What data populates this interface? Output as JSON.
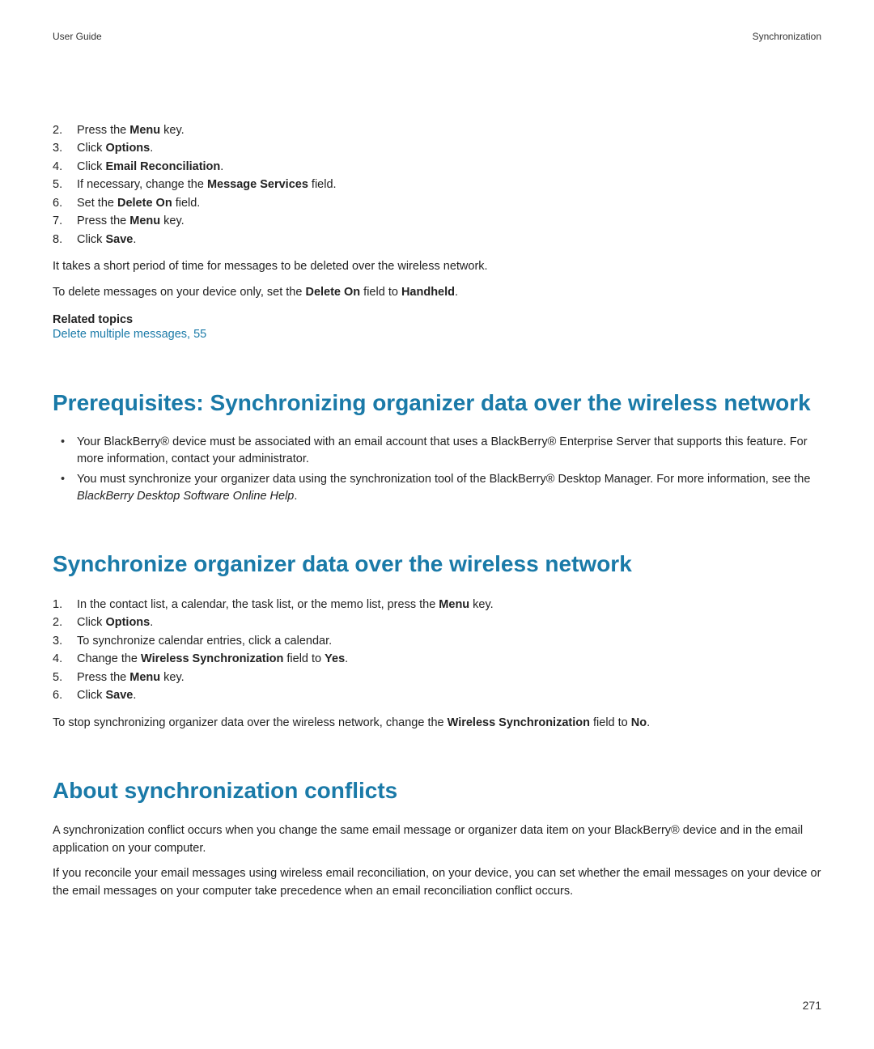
{
  "header": {
    "left": "User Guide",
    "right": "Synchronization"
  },
  "section1": {
    "steps": [
      {
        "num": "2.",
        "prefix": "Press the ",
        "bold": "Menu",
        "suffix": " key."
      },
      {
        "num": "3.",
        "prefix": "Click ",
        "bold": "Options",
        "suffix": "."
      },
      {
        "num": "4.",
        "prefix": "Click ",
        "bold": "Email Reconciliation",
        "suffix": "."
      },
      {
        "num": "5.",
        "prefix": "If necessary, change the ",
        "bold": "Message Services",
        "suffix": " field."
      },
      {
        "num": "6.",
        "prefix": "Set the ",
        "bold": "Delete On",
        "suffix": " field."
      },
      {
        "num": "7.",
        "prefix": "Press the ",
        "bold": "Menu",
        "suffix": " key."
      },
      {
        "num": "8.",
        "prefix": "Click ",
        "bold": "Save",
        "suffix": "."
      }
    ],
    "para1": "It takes a short period of time for messages to be deleted over the wireless network.",
    "para2_prefix": "To delete messages on your device only, set the ",
    "para2_bold1": "Delete On",
    "para2_mid": " field to ",
    "para2_bold2": "Handheld",
    "para2_suffix": ".",
    "related_heading": "Related topics",
    "related_link": "Delete multiple messages, 55"
  },
  "section2": {
    "heading": "Prerequisites: Synchronizing organizer data over the wireless network",
    "bullets": [
      {
        "text": "Your BlackBerry® device must be associated with an email account that uses a BlackBerry® Enterprise Server that supports this feature. For more information, contact your administrator."
      },
      {
        "text_prefix": "You must synchronize your organizer data using the synchronization tool of the BlackBerry® Desktop Manager. For more information, see the  ",
        "text_italic": "BlackBerry Desktop Software Online Help",
        "text_suffix": "."
      }
    ]
  },
  "section3": {
    "heading": "Synchronize organizer data over the wireless network",
    "steps": [
      {
        "num": "1.",
        "prefix": "In the contact list, a calendar, the task list, or the memo list, press the ",
        "bold": "Menu",
        "suffix": " key."
      },
      {
        "num": "2.",
        "prefix": "Click ",
        "bold": "Options",
        "suffix": "."
      },
      {
        "num": "3.",
        "prefix": "To synchronize calendar entries, click a calendar.",
        "bold": "",
        "suffix": ""
      },
      {
        "num": "4.",
        "prefix": "Change the ",
        "bold": "Wireless Synchronization",
        "suffix_mid": " field to ",
        "bold2": "Yes",
        "suffix": "."
      },
      {
        "num": "5.",
        "prefix": "Press the ",
        "bold": "Menu",
        "suffix": " key."
      },
      {
        "num": "6.",
        "prefix": "Click ",
        "bold": "Save",
        "suffix": "."
      }
    ],
    "para_prefix": "To stop synchronizing organizer data over the wireless network, change the ",
    "para_bold1": "Wireless Synchronization",
    "para_mid": " field to ",
    "para_bold2": "No",
    "para_suffix": "."
  },
  "section4": {
    "heading": "About synchronization conflicts",
    "para1": "A synchronization conflict occurs when you change the same email message or organizer data item on your BlackBerry® device and in the email application on your computer.",
    "para2": "If you reconcile your email messages using wireless email reconciliation, on your device, you can set whether the email messages on your device or the email messages on your computer take precedence when an email reconciliation conflict occurs."
  },
  "page_number": "271"
}
